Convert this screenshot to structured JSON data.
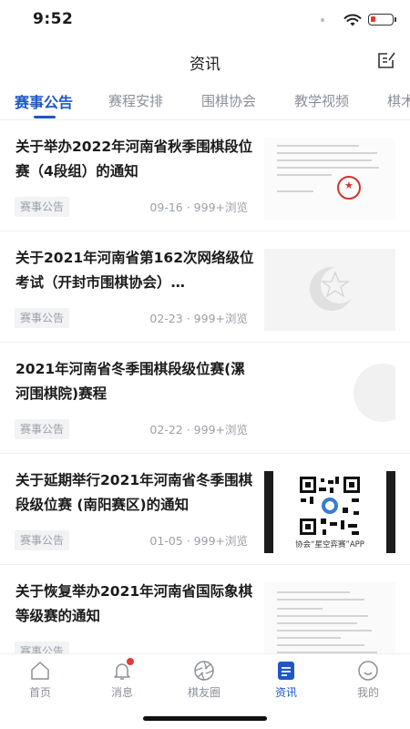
{
  "status_bar": {
    "time": "9:52"
  },
  "header": {
    "title": "资讯",
    "edit_icon": "edit-note-icon"
  },
  "tabs": [
    {
      "label": "赛事公告",
      "active": true
    },
    {
      "label": "赛程安排",
      "active": false
    },
    {
      "label": "围棋协会",
      "active": false
    },
    {
      "label": "教学视频",
      "active": false
    },
    {
      "label": "棋术",
      "active": false
    }
  ],
  "news": [
    {
      "title": "关于举办2022年河南省秋季围棋段位赛（4段组）的通知",
      "category": "赛事公告",
      "meta": "09-16 · 999+浏览",
      "thumb": "document-with-seal"
    },
    {
      "title": "关于2021年河南省第162次网络级位考试（开封市围棋协会）…",
      "category": "赛事公告",
      "meta": "02-23 · 999+浏览",
      "thumb": "star-crescent-logo"
    },
    {
      "title": "2021年河南省冬季围棋段级位赛(漯河围棋院)赛程",
      "category": "赛事公告",
      "meta": "02-22 · 999+浏览",
      "thumb": "blank"
    },
    {
      "title": "关于延期举行2021年河南省冬季围棋段级位赛 (南阳赛区)的通知",
      "category": "赛事公告",
      "meta": "01-05 · 999+浏览",
      "thumb": "qr-code",
      "thumb_caption": "协会“星空弈赛”APP"
    },
    {
      "title": "关于恢复举办2021年河南省国际象棋等级赛的通知",
      "category": "赛事公告",
      "meta": "",
      "thumb": "document"
    }
  ],
  "bottom_nav": [
    {
      "label": "首页",
      "icon": "home-icon",
      "active": false
    },
    {
      "label": "消息",
      "icon": "bell-icon",
      "active": false,
      "has_badge": true
    },
    {
      "label": "棋友圈",
      "icon": "aperture-icon",
      "active": false
    },
    {
      "label": "资讯",
      "icon": "news-icon",
      "active": true
    },
    {
      "label": "我的",
      "icon": "profile-icon",
      "active": false
    }
  ],
  "colors": {
    "accent": "#1e56c8",
    "badge_red": "#e53935",
    "muted": "#8a8f99"
  }
}
